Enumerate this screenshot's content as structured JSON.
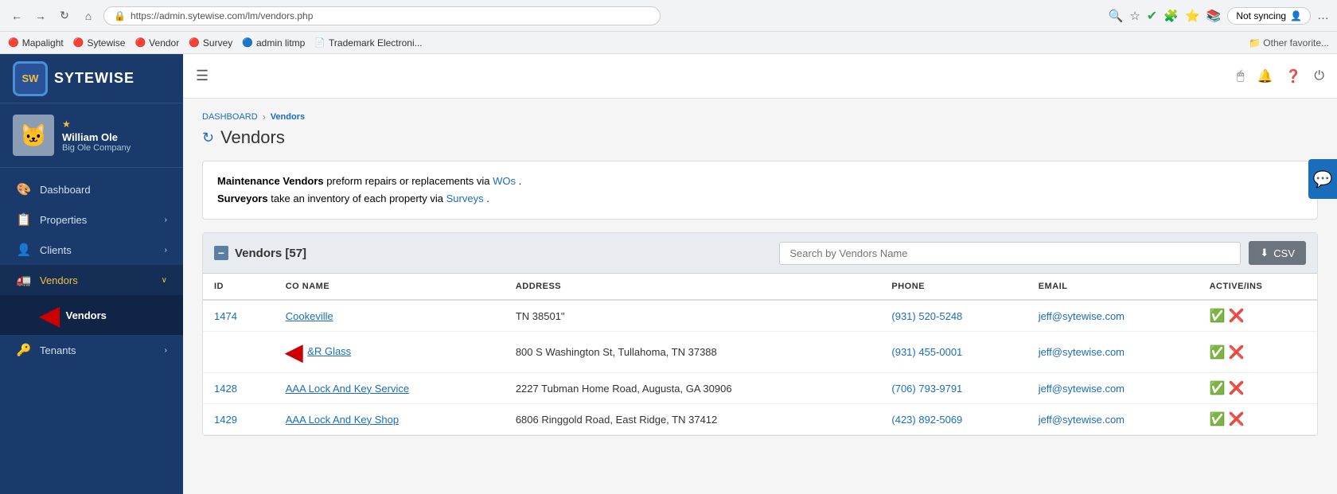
{
  "browser": {
    "url": "https://admin.sytewise.com/lm/vendors.php",
    "not_syncing_label": "Not syncing",
    "bookmarks": [
      {
        "label": "Mapalight",
        "icon": "🔴"
      },
      {
        "label": "Sytewise",
        "icon": "🔴"
      },
      {
        "label": "Vendor",
        "icon": "🔴"
      },
      {
        "label": "Survey",
        "icon": "🔴"
      },
      {
        "label": "admin litmp",
        "icon": "🔵"
      },
      {
        "label": "Trademark Electroni...",
        "icon": "📄"
      }
    ],
    "other_favorites": "Other favorite..."
  },
  "sidebar": {
    "logo_text": "SYTEWISE",
    "user": {
      "name": "William Ole",
      "company": "Big Ole Company"
    },
    "nav_items": [
      {
        "label": "Dashboard",
        "icon": "🎨",
        "active": false
      },
      {
        "label": "Properties",
        "icon": "📋",
        "has_arrow": true,
        "active": false
      },
      {
        "label": "Clients",
        "icon": "👤",
        "has_arrow": true,
        "active": false
      },
      {
        "label": "Vendors",
        "icon": "🚛",
        "has_arrow": true,
        "active": true,
        "yellow": true
      },
      {
        "label": "Tenants",
        "icon": "🔑",
        "has_arrow": true,
        "active": false
      }
    ],
    "sub_items": [
      {
        "label": "Vendors",
        "active": true
      }
    ]
  },
  "header": {
    "menu_icon": "☰",
    "icons": [
      "🖱",
      "🔔",
      "❓",
      "⏻"
    ]
  },
  "breadcrumb": {
    "home": "DASHBOARD",
    "separator": "›",
    "current": "Vendors"
  },
  "page": {
    "title": "Vendors",
    "refresh_icon": "↻",
    "info_text_1": "Maintenance Vendors preform repairs or replacements via ",
    "info_link_1": "WOs",
    "info_text_2": ".",
    "info_text_3": "Surveyors",
    "info_text_4": " take an inventory of each property via ",
    "info_link_2": "Surveys",
    "info_text_5": "."
  },
  "vendors_section": {
    "title": "Vendors [57]",
    "search_placeholder": "Search by Vendors Name",
    "csv_label": "⬇ CSV",
    "table": {
      "headers": [
        "ID",
        "CO NAME",
        "ADDRESS",
        "PHONE",
        "EMAIL",
        "ACTIVE/INS"
      ],
      "rows": [
        {
          "id": "1474",
          "name": "Cookeville",
          "address": "TN 38501\"",
          "phone": "(931) 520-5248",
          "email": "jeff@sytewise.com",
          "active": true,
          "ins": false
        },
        {
          "id": "",
          "name": "&R Glass",
          "address": "800 S Washington St, Tullahoma, TN 37388",
          "phone": "(931) 455-0001",
          "email": "jeff@sytewise.com",
          "active": true,
          "ins": false,
          "has_arrow": true
        },
        {
          "id": "1428",
          "name": "AAA Lock And Key Service",
          "address": "2227 Tubman Home Road, Augusta, GA 30906",
          "phone": "(706) 793-9791",
          "email": "jeff@sytewise.com",
          "active": true,
          "ins": false
        },
        {
          "id": "1429",
          "name": "AAA Lock And Key Shop",
          "address": "6806 Ringgold Road, East Ridge, TN 37412",
          "phone": "(423) 892-5069",
          "email": "jeff@sytewise.com",
          "active": true,
          "ins": false
        }
      ]
    }
  }
}
